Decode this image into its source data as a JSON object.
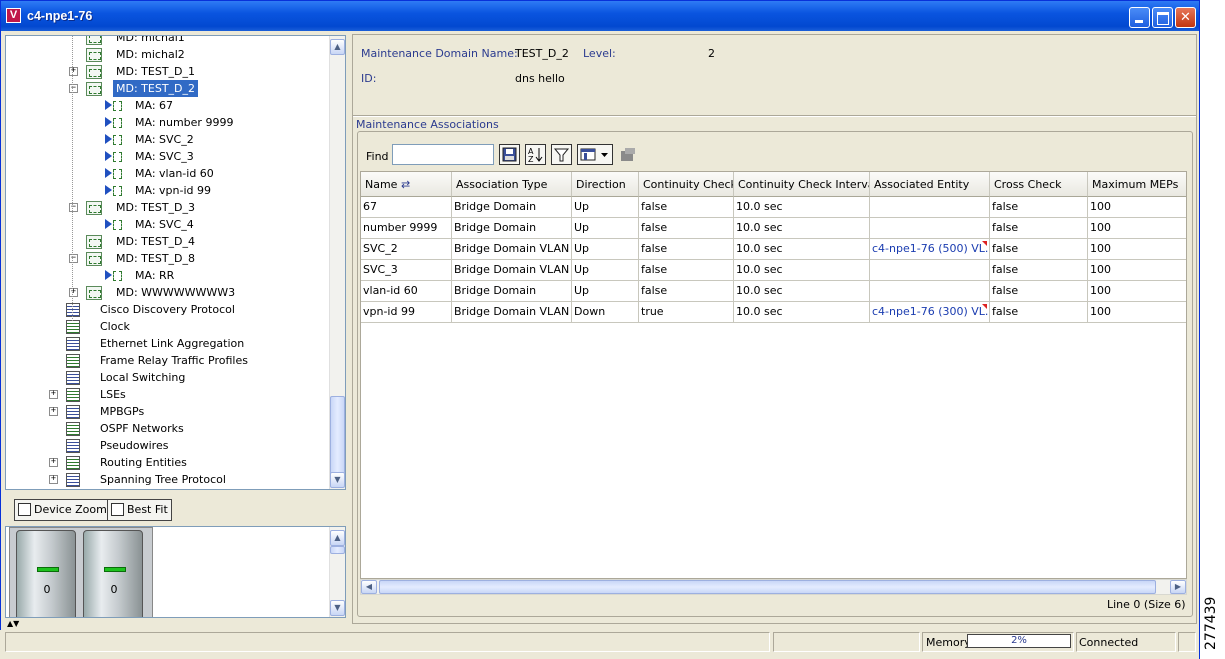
{
  "window": {
    "title": "c4-npe1-76",
    "app_icon": "V"
  },
  "tree": {
    "items": [
      {
        "label": "MD: michal1",
        "kind": "md"
      },
      {
        "label": "MD: michal2",
        "kind": "md"
      },
      {
        "label": "MD: TEST_D_1",
        "kind": "md",
        "expander": "+"
      },
      {
        "label": "MD: TEST_D_2",
        "kind": "md",
        "expander": "-",
        "selected": true
      },
      {
        "label": "MA: 67",
        "kind": "ma"
      },
      {
        "label": "MA: number 9999",
        "kind": "ma"
      },
      {
        "label": "MA: SVC_2",
        "kind": "ma"
      },
      {
        "label": "MA: SVC_3",
        "kind": "ma"
      },
      {
        "label": "MA: vlan-id 60",
        "kind": "ma"
      },
      {
        "label": "MA: vpn-id 99",
        "kind": "ma"
      },
      {
        "label": "MD: TEST_D_3",
        "kind": "md",
        "expander": "-"
      },
      {
        "label": "MA: SVC_4",
        "kind": "ma"
      },
      {
        "label": "MD: TEST_D_4",
        "kind": "md"
      },
      {
        "label": "MD: TEST_D_8",
        "kind": "md",
        "expander": "-"
      },
      {
        "label": "MA: RR",
        "kind": "ma"
      },
      {
        "label": "MD: WWWWWWWW3",
        "kind": "md",
        "expander": "+"
      },
      {
        "label": "Cisco Discovery Protocol",
        "kind": "tbl"
      },
      {
        "label": "Clock",
        "kind": "tbl"
      },
      {
        "label": "Ethernet Link Aggregation",
        "kind": "tbl"
      },
      {
        "label": "Frame Relay Traffic Profiles",
        "kind": "tbl"
      },
      {
        "label": "Local Switching",
        "kind": "tbl"
      },
      {
        "label": "LSEs",
        "kind": "tbl",
        "expander": "+"
      },
      {
        "label": "MPBGPs",
        "kind": "tbl",
        "expander": "+"
      },
      {
        "label": "OSPF Networks",
        "kind": "tbl"
      },
      {
        "label": "Pseudowires",
        "kind": "tbl"
      },
      {
        "label": "Routing Entities",
        "kind": "tbl",
        "expander": "+"
      },
      {
        "label": "Spanning Tree Protocol",
        "kind": "tbl",
        "expander": "+"
      }
    ]
  },
  "zoom": {
    "device_zoom": "Device Zoom",
    "best_fit": "Best Fit"
  },
  "preview": {
    "unit_labels": [
      "0",
      "0"
    ]
  },
  "details": {
    "md_name_label": "Maintenance Domain Name:",
    "md_name_value": "TEST_D_2",
    "level_label": "Level:",
    "level_value": "2",
    "id_label": "ID:",
    "id_value": "dns hello"
  },
  "associations": {
    "title": "Maintenance Associations",
    "find_label": "Find :",
    "find_value": "",
    "columns": [
      "Name",
      "Association Type",
      "Direction",
      "Continuity Check",
      "Continuity Check Interval",
      "Associated Entity",
      "Cross Check",
      "Maximum MEPs"
    ],
    "rows": [
      [
        "67",
        "Bridge Domain",
        "Up",
        "false",
        "10.0 sec",
        "",
        "false",
        "100"
      ],
      [
        "number 9999",
        "Bridge Domain",
        "Up",
        "false",
        "10.0 sec",
        "",
        "false",
        "100"
      ],
      [
        "SVC_2",
        "Bridge Domain VLAN",
        "Up",
        "false",
        "10.0 sec",
        "c4-npe1-76 (500) VL...",
        "false",
        "100"
      ],
      [
        "SVC_3",
        "Bridge Domain VLAN",
        "Up",
        "false",
        "10.0 sec",
        "",
        "false",
        "100"
      ],
      [
        "vlan-id 60",
        "Bridge Domain",
        "Up",
        "false",
        "10.0 sec",
        "",
        "false",
        "100"
      ],
      [
        "vpn-id 99",
        "Bridge Domain VLAN",
        "Down",
        "true",
        "10.0 sec",
        "c4-npe1-76 (300) VL...",
        "false",
        "100"
      ]
    ],
    "line_count": "Line 0 (Size 6)"
  },
  "statusbar": {
    "memory_label": "Memory:",
    "memory_value": "2%",
    "connection": "Connected"
  },
  "side_id": "277439"
}
